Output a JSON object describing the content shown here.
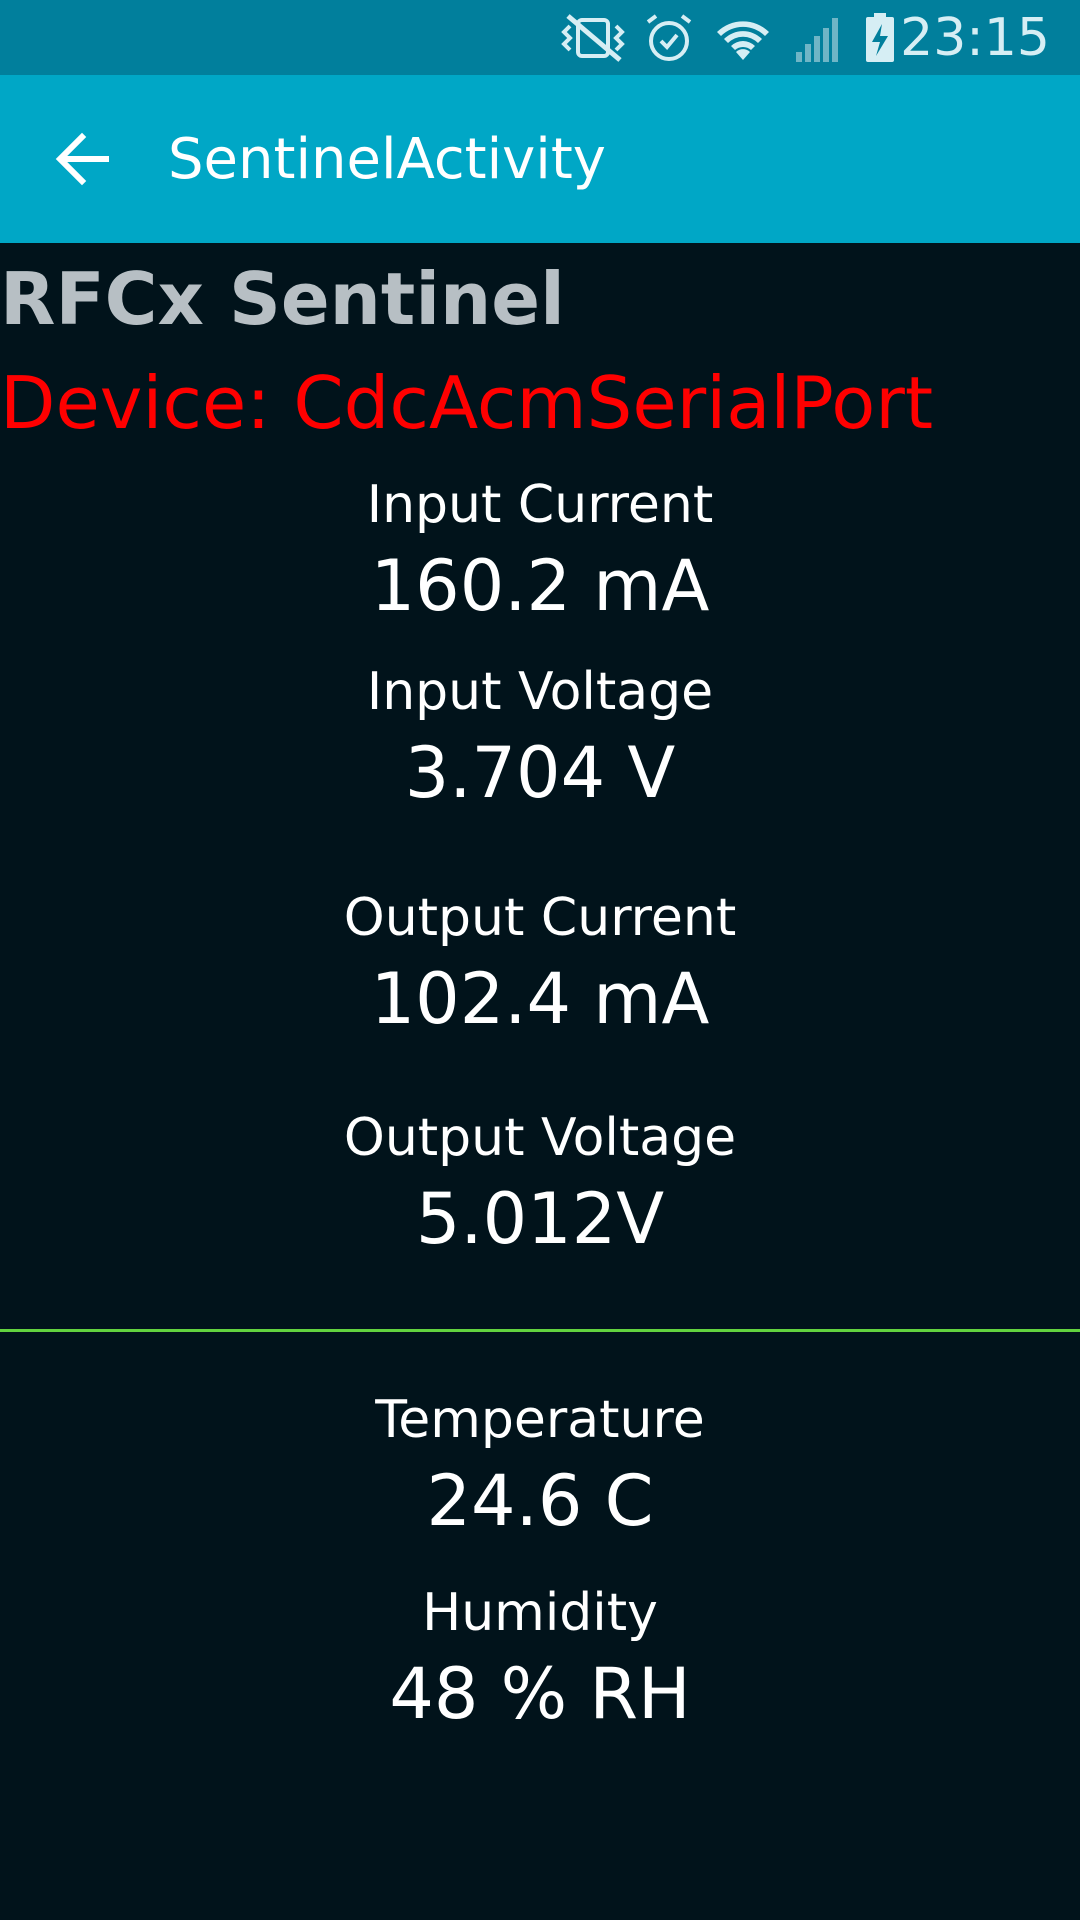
{
  "status_bar": {
    "time": "23:15",
    "icons": [
      "mute-vibrate-icon",
      "alarm-icon",
      "wifi-icon",
      "cell-signal-icon",
      "battery-charging-icon"
    ]
  },
  "app_bar": {
    "title": "SentinelActivity"
  },
  "content": {
    "heading": "RFCx Sentinel",
    "device": "Device: CdcAcmSerialPort",
    "readings": [
      {
        "label": "Input Current",
        "value": "160.2 mA"
      },
      {
        "label": "Input Voltage",
        "value": "3.704 V"
      },
      {
        "label": "Output Current",
        "value": "102.4 mA"
      },
      {
        "label": "Output Voltage",
        "value": "5.012V"
      },
      {
        "label": "Temperature",
        "value": "24.6 C"
      },
      {
        "label": "Humidity",
        "value": "48 % RH"
      }
    ]
  },
  "colors": {
    "status_bar": "#017f9c",
    "app_bar": "#00a7c6",
    "background": "#01131b",
    "heading": "#b7bfc4",
    "device_text": "#ff0000",
    "divider": "#62d33f"
  }
}
